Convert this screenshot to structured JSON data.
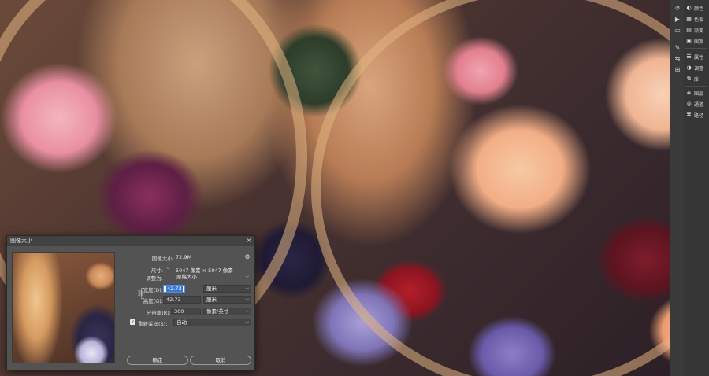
{
  "right_panels": {
    "items": [
      {
        "icon": "palette-icon",
        "label": "颜色"
      },
      {
        "icon": "swatches-icon",
        "label": "色板"
      },
      {
        "icon": "gradients-icon",
        "label": "渐变"
      },
      {
        "icon": "patterns-icon",
        "label": "图案"
      },
      {
        "icon": "properties-icon",
        "label": "属性"
      },
      {
        "icon": "adjustments-icon",
        "label": "调整"
      },
      {
        "icon": "libraries-icon",
        "label": "库"
      },
      {
        "icon": "layers-icon",
        "label": "图层"
      },
      {
        "icon": "channels-icon",
        "label": "通道"
      },
      {
        "icon": "paths-icon",
        "label": "路径"
      }
    ]
  },
  "dialog": {
    "title": "图像大小",
    "close": "×",
    "image_size_label": "图像大小:",
    "image_size_value": "72.9M",
    "dimensions_label": "尺寸:",
    "dimensions_value": "5047 像素 × 5047 像素",
    "fit_to_label": "调整为:",
    "fit_to_value": "原稿大小",
    "width_label": "宽度(D):",
    "width_value": "42.73",
    "width_unit": "厘米",
    "height_label": "高度(G):",
    "height_value": "42.73",
    "height_unit": "厘米",
    "resolution_label": "分辨率(R):",
    "resolution_value": "300",
    "resolution_unit": "像素/英寸",
    "resample_label": "重新采样(S):",
    "resample_value": "自动",
    "ok_button": "确定",
    "cancel_button": "取消"
  }
}
